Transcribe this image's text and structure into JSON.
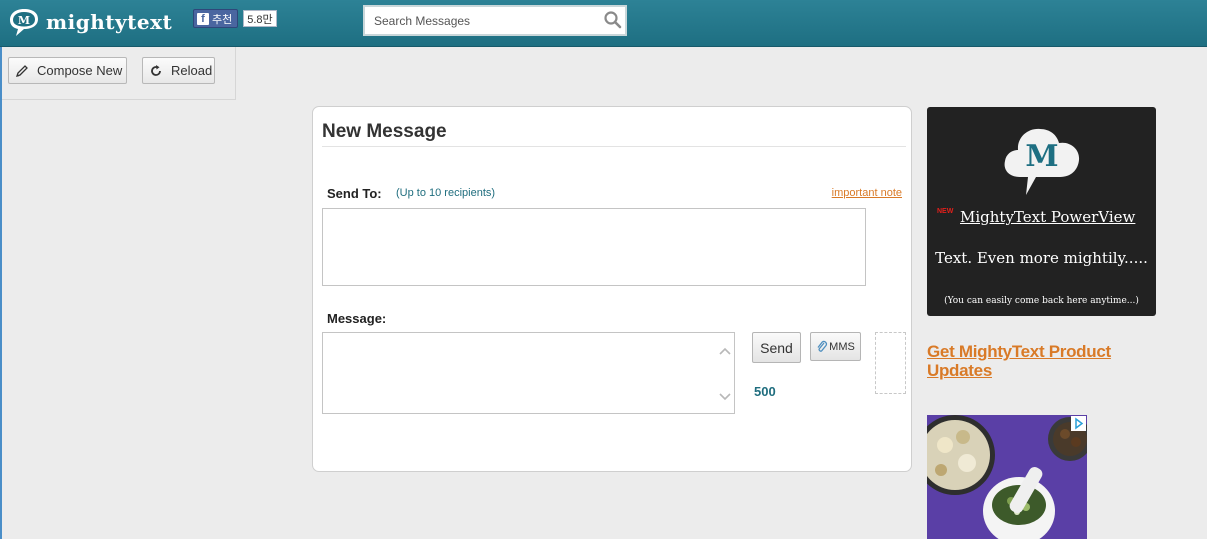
{
  "header": {
    "logo_text": "mightytext",
    "facebook_like_label": "추천",
    "facebook_like_count": "5.8만",
    "search_placeholder": "Search Messages"
  },
  "toolbar": {
    "compose_label": "Compose New",
    "reload_label": "Reload"
  },
  "composer": {
    "title": "New Message",
    "send_to_label": "Send To:",
    "recipients_hint": "(Up to 10 recipients)",
    "important_note_link": "important note",
    "message_label": "Message:",
    "send_button": "Send",
    "mms_button": "MMS",
    "char_count": "500"
  },
  "promo": {
    "logo_letter": "M",
    "new_tag": "NEW",
    "powerview_link": "MightyText PowerView",
    "tagline": "Text. Even more mightily.....",
    "small_note": "(You can easily come back here anytime...)"
  },
  "updates_link": "Get MightyText Product Updates",
  "colors": {
    "header_teal": "#1e6f82",
    "accent_orange": "#d97a27",
    "counter_teal": "#1f6d7e",
    "facebook_blue": "#4a66a0"
  }
}
